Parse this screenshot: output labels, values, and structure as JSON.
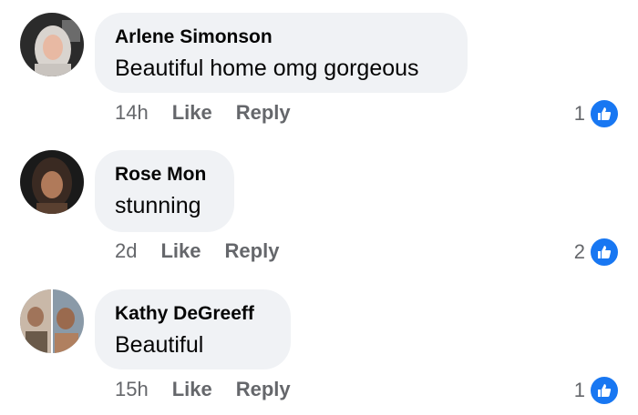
{
  "colors": {
    "bubble": "#f0f2f5",
    "meta": "#65676b",
    "like_blue": "#1877f2"
  },
  "comments": [
    {
      "author": "Arlene Simonson",
      "text": "Beautiful home omg gorgeous",
      "time": "14h",
      "like_label": "Like",
      "reply_label": "Reply",
      "reactions": "1",
      "reaction_icon": "thumbs-up-icon"
    },
    {
      "author": "Rose Mon",
      "text": "stunning",
      "time": "2d",
      "like_label": "Like",
      "reply_label": "Reply",
      "reactions": "2",
      "reaction_icon": "thumbs-up-icon"
    },
    {
      "author": "Kathy DeGreeff",
      "text": "Beautiful",
      "time": "15h",
      "like_label": "Like",
      "reply_label": "Reply",
      "reactions": "1",
      "reaction_icon": "thumbs-up-icon"
    }
  ]
}
